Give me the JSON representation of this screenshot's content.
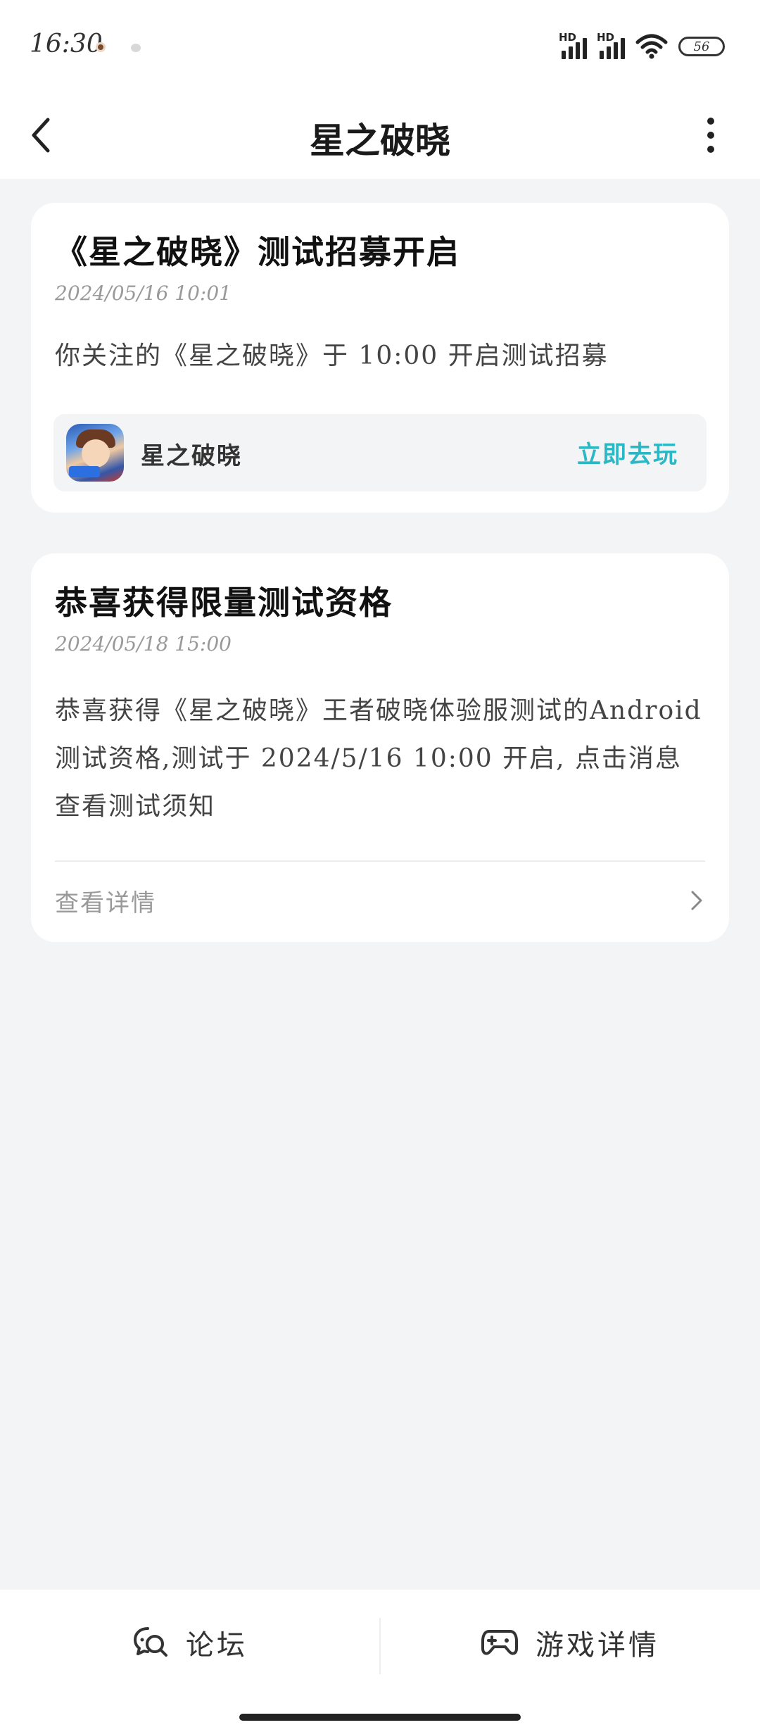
{
  "status_bar": {
    "time": "16:30",
    "battery": "56",
    "signal_label_1": "HD",
    "signal_label_2": "HD"
  },
  "header": {
    "title": "星之破晓",
    "back_icon": "chevron-left-icon",
    "more_icon": "more-vertical-icon"
  },
  "messages": [
    {
      "title": "《星之破晓》测试招募开启",
      "date": "2024/05/16 10:01",
      "body": "你关注的《星之破晓》于 10:00 开启测试招募",
      "game": {
        "name": "星之破晓",
        "action_label": "立即去玩"
      }
    },
    {
      "title": "恭喜获得限量测试资格",
      "date": "2024/05/18 15:00",
      "body": "恭喜获得《星之破晓》王者破晓体验服测试的Android测试资格,测试于 2024/5/16 10:00 开启, 点击消息查看测试须知",
      "details_label": "查看详情"
    }
  ],
  "bottom_bar": {
    "forum_label": "论坛",
    "game_details_label": "游戏详情"
  },
  "colors": {
    "accent": "#2bb7c4",
    "background": "#f3f4f6",
    "card": "#ffffff"
  }
}
